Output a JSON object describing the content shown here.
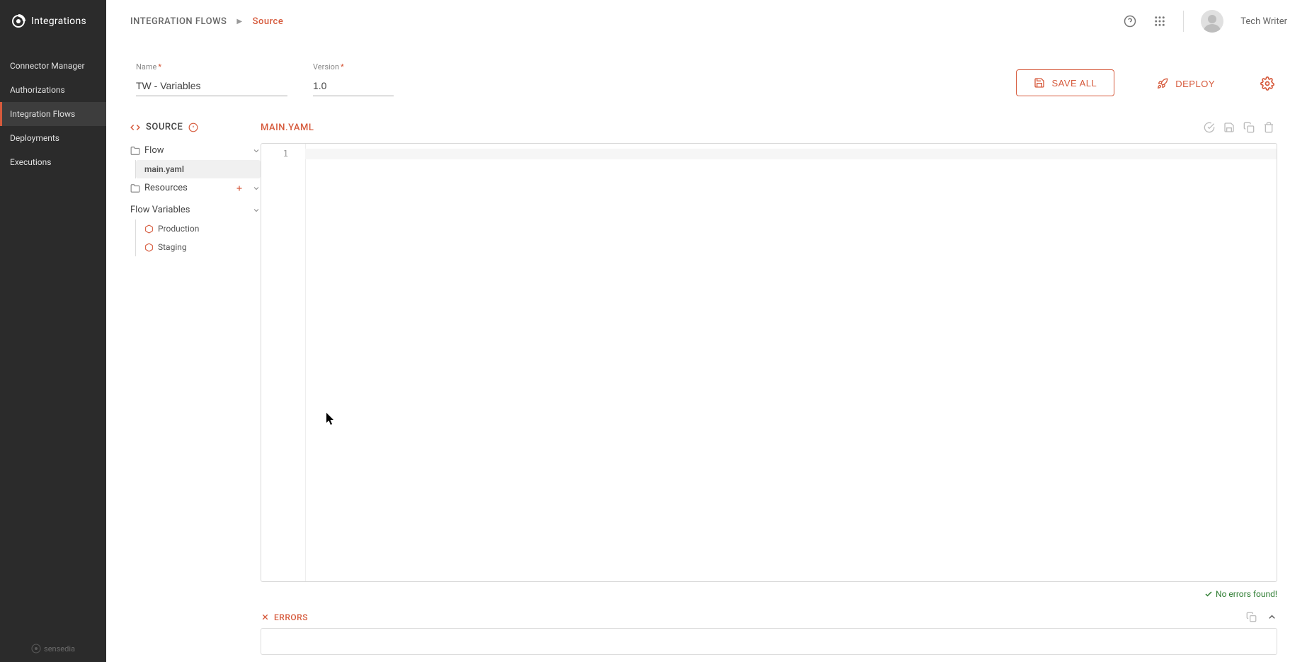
{
  "app": {
    "title": "Integrations"
  },
  "sidebar": {
    "items": [
      {
        "label": "Connector Manager",
        "active": false
      },
      {
        "label": "Authorizations",
        "active": false
      },
      {
        "label": "Integration Flows",
        "active": true
      },
      {
        "label": "Deployments",
        "active": false
      },
      {
        "label": "Executions",
        "active": false
      }
    ],
    "footer_brand": "sensedia"
  },
  "header": {
    "breadcrumb_root": "INTEGRATION FLOWS",
    "breadcrumb_current": "Source",
    "user_name": "Tech Writer"
  },
  "form": {
    "name_label": "Name",
    "name_value": "TW - Variables",
    "version_label": "Version",
    "version_value": "1.0",
    "save_all_label": "SAVE ALL",
    "deploy_label": "DEPLOY"
  },
  "source_tree": {
    "heading": "SOURCE",
    "folders": {
      "flow": {
        "label": "Flow",
        "files": [
          {
            "name": "main.yaml",
            "active": true
          }
        ]
      },
      "resources": {
        "label": "Resources"
      }
    },
    "flow_variables": {
      "label": "Flow Variables",
      "items": [
        {
          "name": "Production"
        },
        {
          "name": "Staging"
        }
      ]
    }
  },
  "editor": {
    "tab_title": "MAIN.YAML",
    "gutter_start": "1",
    "status_ok": "No errors found!"
  },
  "errors_panel": {
    "heading": "ERRORS"
  }
}
